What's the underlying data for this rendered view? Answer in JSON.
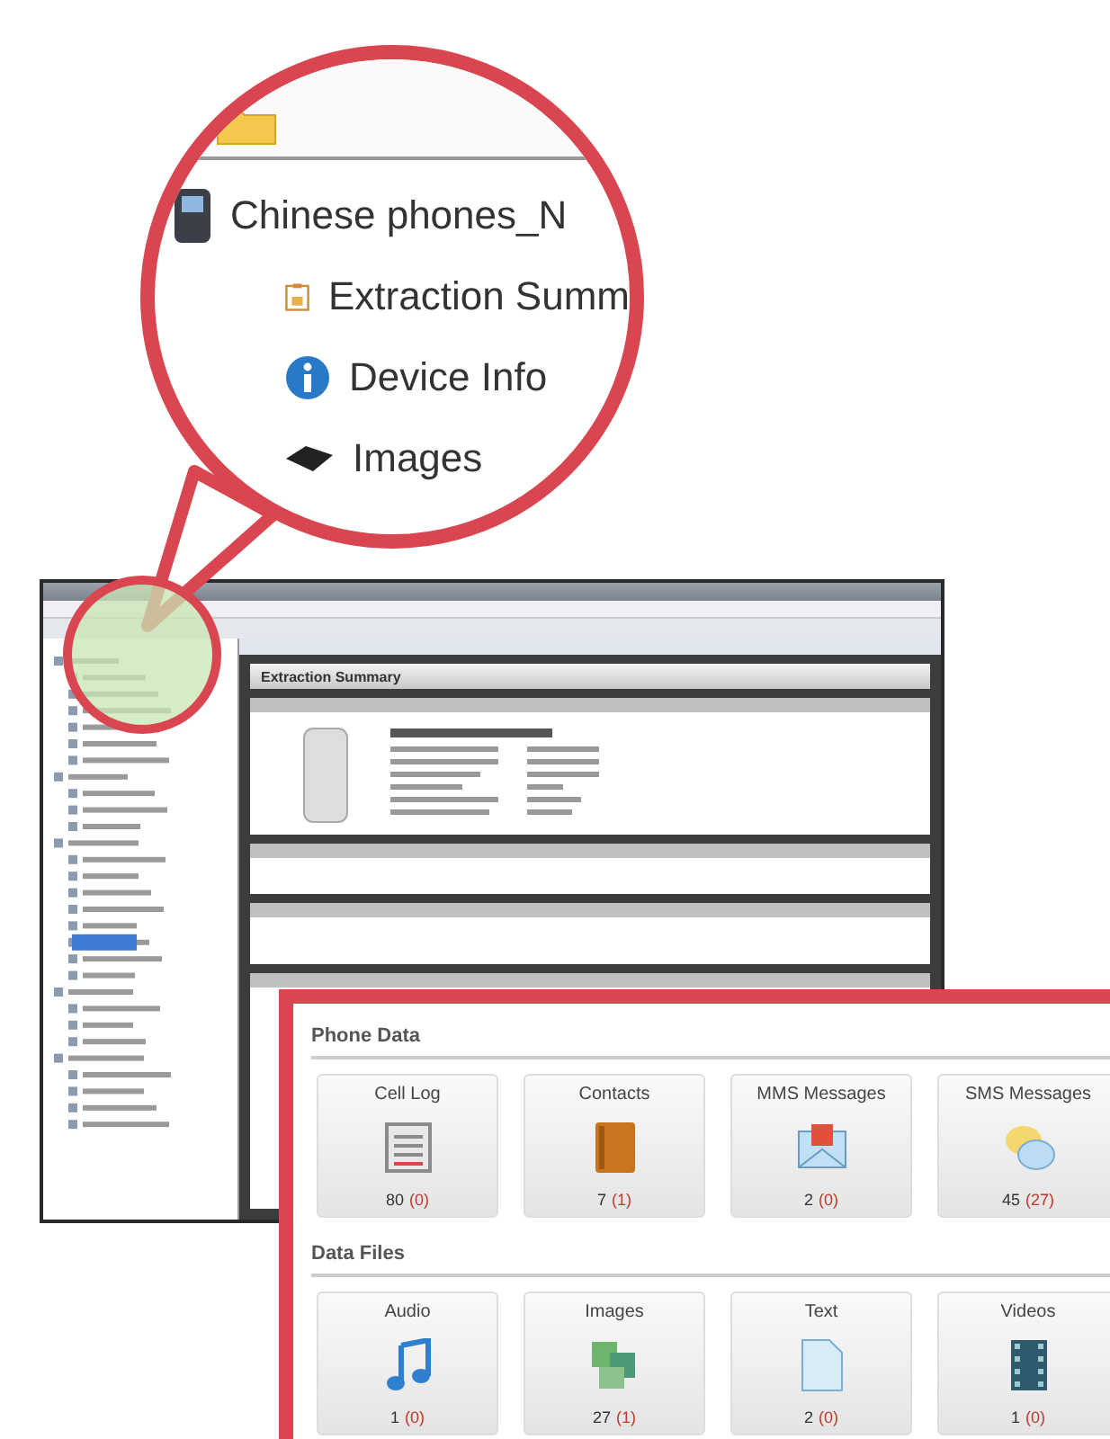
{
  "magnifier": {
    "tree": [
      {
        "label": "Chinese phones_N",
        "kind": "device",
        "children": [
          {
            "label": "Extraction Summ",
            "kind": "summary"
          },
          {
            "label": "Device Info",
            "kind": "info"
          },
          {
            "label": "Images",
            "kind": "images"
          }
        ]
      }
    ]
  },
  "application_window": {
    "panel_title": "Extraction Summary"
  },
  "zoom_panel": {
    "sections": [
      {
        "title": "Phone Data",
        "tiles": [
          {
            "label": "Cell Log",
            "kind": "calllog",
            "count": "80",
            "new": "(0)"
          },
          {
            "label": "Contacts",
            "kind": "contacts",
            "count": "7",
            "new": "(1)"
          },
          {
            "label": "MMS Messages",
            "kind": "mms",
            "count": "2",
            "new": "(0)"
          },
          {
            "label": "SMS Messages",
            "kind": "sms",
            "count": "45",
            "new": "(27)"
          }
        ]
      },
      {
        "title": "Data Files",
        "tiles": [
          {
            "label": "Audio",
            "kind": "audio",
            "count": "1",
            "new": "(0)"
          },
          {
            "label": "Images",
            "kind": "images",
            "count": "27",
            "new": "(1)"
          },
          {
            "label": "Text",
            "kind": "text",
            "count": "2",
            "new": "(0)"
          },
          {
            "label": "Videos",
            "kind": "video",
            "count": "1",
            "new": "(0)"
          }
        ]
      }
    ]
  }
}
